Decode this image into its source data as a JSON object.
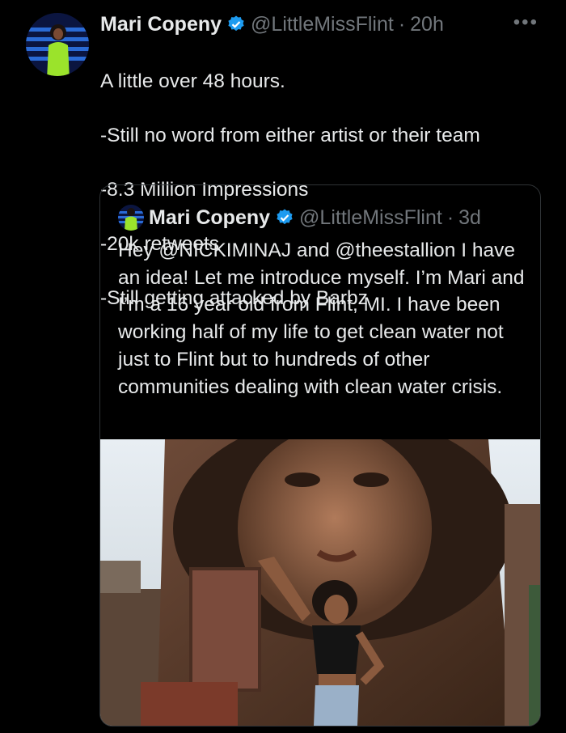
{
  "tweet": {
    "name": "Mari Copeny",
    "handle": "@LittleMissFlint",
    "time": "20h",
    "more_icon": "more-dots-icon",
    "text_lines": [
      "A little over 48 hours.",
      "-Still no word from either artist or their team",
      "-8.3 Million Impressions",
      "-20k retweets",
      "-Still getting attacked by Barbz"
    ]
  },
  "quote": {
    "name": "Mari Copeny",
    "handle": "@LittleMissFlint",
    "time": "3d",
    "text": "Hey @NICKIMINAJ and @theestallion I have an idea! Let me introduce myself. I’m Mari and I’m a 16 year old from Flint, MI.  I have been working half of my life to get clean water not just to Flint but to hundreds of other communities dealing with clean water crisis.",
    "image_icon": "mural-photo"
  },
  "colors": {
    "background": "#000000",
    "text": "#e7e9ea",
    "muted": "#71767b",
    "verified": "#1d9bf0",
    "border": "#2f3336"
  }
}
